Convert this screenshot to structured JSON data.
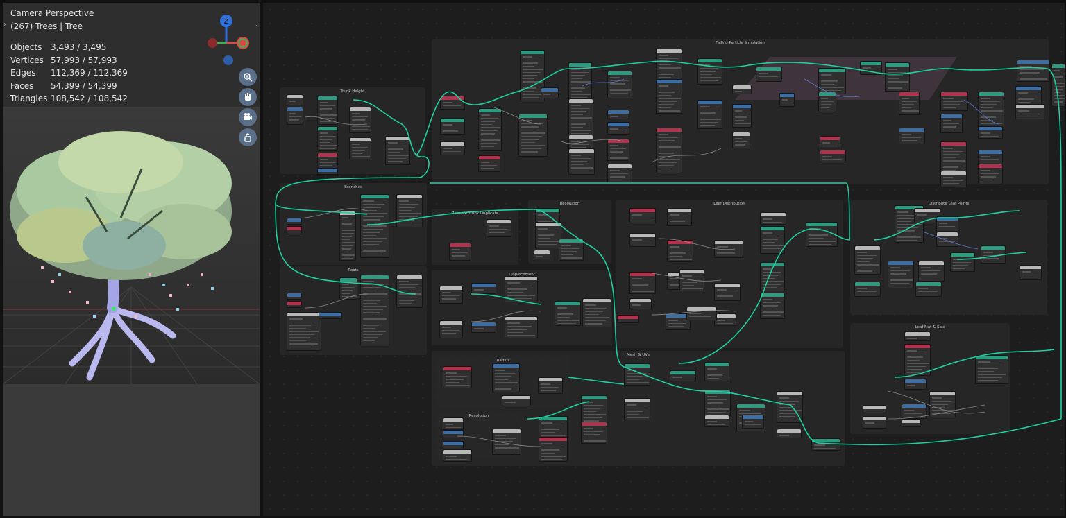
{
  "viewport": {
    "title": "Camera Perspective",
    "subtitle": "(267) Trees | Tree",
    "stats": [
      {
        "label": "Objects",
        "value": "3,493 / 3,495"
      },
      {
        "label": "Vertices",
        "value": "57,993 / 57,993"
      },
      {
        "label": "Edges",
        "value": "112,369 / 112,369"
      },
      {
        "label": "Faces",
        "value": "54,399 / 54,399"
      },
      {
        "label": "Triangles",
        "value": "108,542 / 108,542"
      }
    ],
    "gizmo_axis_z": "Z",
    "nav_icons": [
      "zoom-icon",
      "hand-pan-icon",
      "camera-icon",
      "lock-icon"
    ]
  },
  "node_editor": {
    "frames": [
      {
        "id": "trunk",
        "title": "Trunk Height"
      },
      {
        "id": "branches",
        "title": "Branches"
      },
      {
        "id": "roots",
        "title": "Roots"
      },
      {
        "id": "falling",
        "title": "Falling Particle Simulation"
      },
      {
        "id": "remove",
        "title": "Remove Trunk Duplicate"
      },
      {
        "id": "resolution1",
        "title": "Resolution"
      },
      {
        "id": "leafdist",
        "title": "Leaf Distribution"
      },
      {
        "id": "distribute",
        "title": "Distribute Leaf Points"
      },
      {
        "id": "displacement",
        "title": "Displacement"
      },
      {
        "id": "mesh",
        "title": "Mesh & UVs"
      },
      {
        "id": "radius",
        "title": "Radius"
      },
      {
        "id": "resolution2",
        "title": "Resolution"
      },
      {
        "id": "leafmat",
        "title": "Leaf Mat & Size"
      }
    ]
  },
  "colors": {
    "wire_main": "#1fd1a0",
    "node_geo": "#2e9a80",
    "node_input": "#b0324d",
    "node_vector": "#3d6ea3",
    "node_output": "#b8b8b8"
  }
}
